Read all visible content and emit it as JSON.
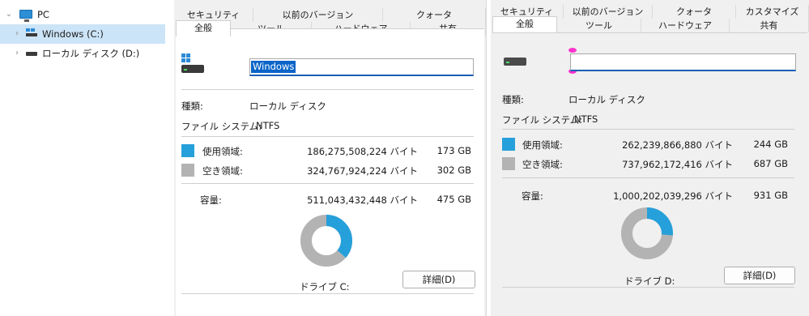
{
  "tree": {
    "items": [
      {
        "label": "PC",
        "expanded": true,
        "icon": "pc-icon"
      },
      {
        "label": "Windows (C:)",
        "selected": true,
        "icon": "windows-drive-icon"
      },
      {
        "label": "ローカル ディスク (D:)",
        "selected": false,
        "icon": "drive-icon"
      }
    ]
  },
  "dialogs": [
    {
      "tabs_row1": [
        "セキュリティ",
        "以前のバージョン",
        "クォータ"
      ],
      "tabs_row2": [
        "全般",
        "ツール",
        "ハードウェア",
        "共有"
      ],
      "active_tab": "全般",
      "volume_name": "Windows",
      "type_label": "種類:",
      "type_value": "ローカル ディスク",
      "fs_label": "ファイル システム:",
      "fs_value": "NTFS",
      "used_label": "使用領域:",
      "used_bytes": "186,275,508,224 バイト",
      "used_gb": "173 GB",
      "free_label": "空き領域:",
      "free_bytes": "324,767,924,224 バイト",
      "free_gb": "302 GB",
      "capacity_label": "容量:",
      "capacity_bytes": "511,043,432,448 バイト",
      "capacity_gb": "475 GB",
      "used_fraction": 0.364,
      "drive_caption": "ドライブ C:",
      "details_button": "詳細(D)"
    },
    {
      "tabs_row1": [
        "セキュリティ",
        "以前のバージョン",
        "クォータ",
        "カスタマイズ"
      ],
      "tabs_row2": [
        "全般",
        "ツール",
        "ハードウェア",
        "共有"
      ],
      "active_tab": "全般",
      "volume_name": "",
      "type_label": "種類:",
      "type_value": "ローカル ディスク",
      "fs_label": "ファイル システム:",
      "fs_value": "NTFS",
      "used_label": "使用領域:",
      "used_bytes": "262,239,866,880 バイト",
      "used_gb": "244 GB",
      "free_label": "空き領域:",
      "free_bytes": "737,962,172,416 バイト",
      "free_gb": "687 GB",
      "capacity_label": "容量:",
      "capacity_bytes": "1,000,202,039,296 バイト",
      "capacity_gb": "931 GB",
      "used_fraction": 0.262,
      "drive_caption": "ドライブ D:",
      "details_button": "詳細(D)"
    }
  ],
  "colors": {
    "used": "#26a0da",
    "free": "#b3b3b3",
    "selection": "#cce4f7",
    "accent": "#1a5fb4"
  }
}
